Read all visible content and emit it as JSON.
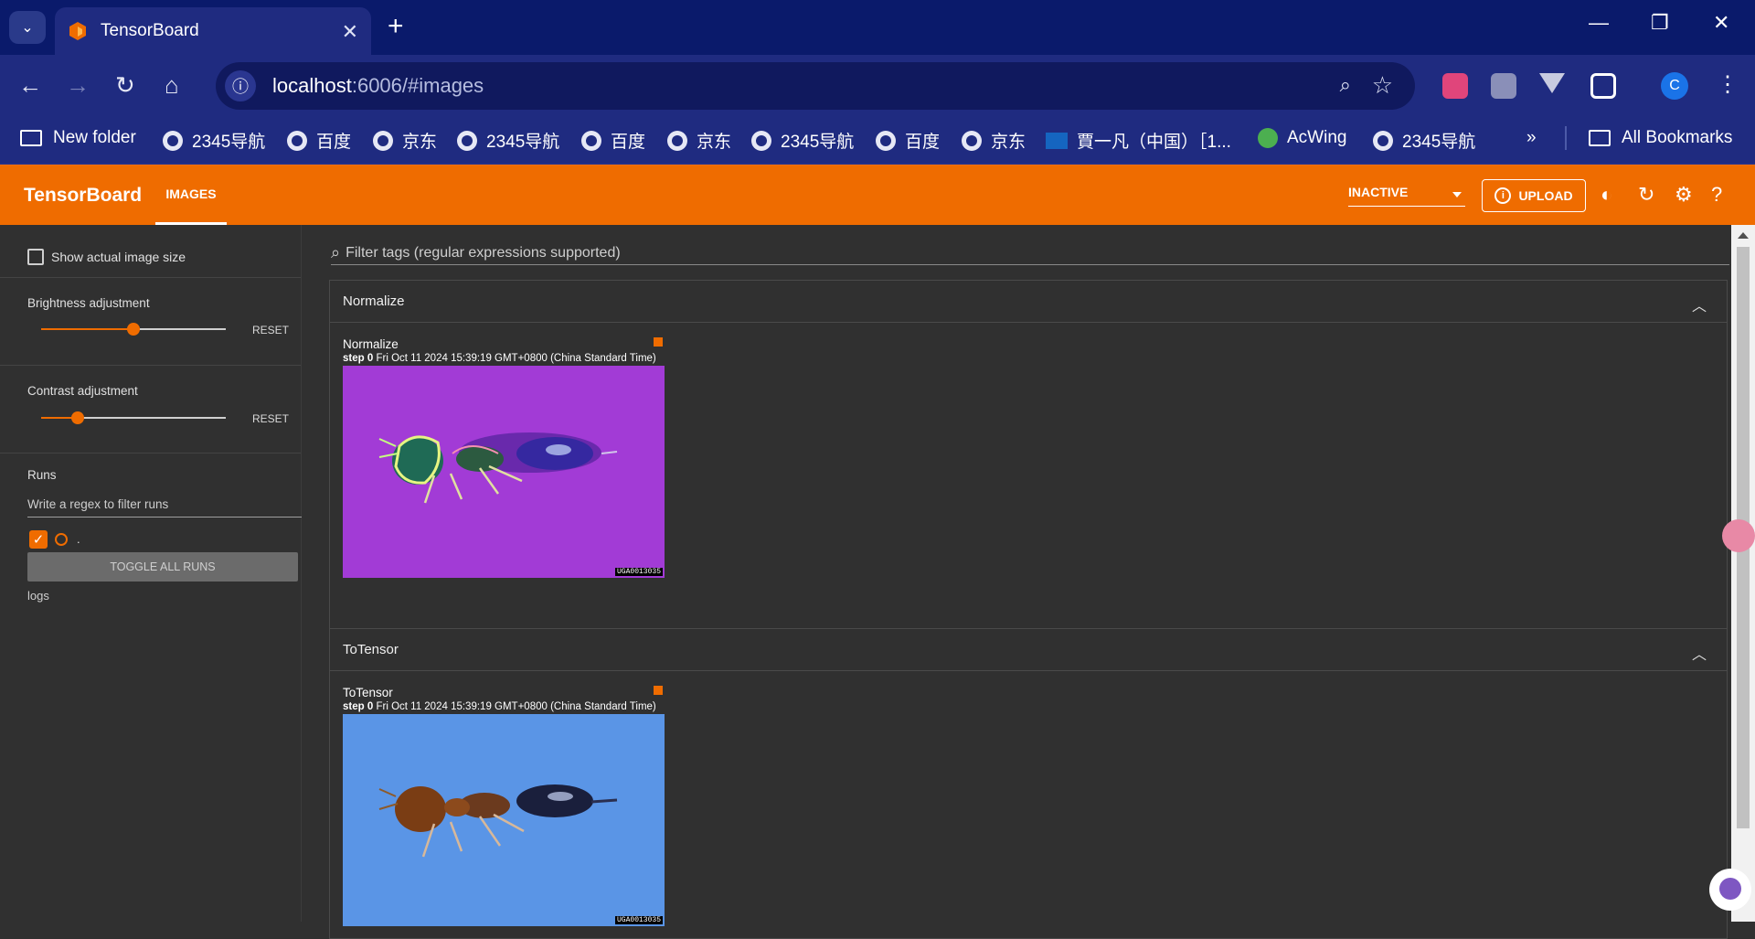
{
  "browser": {
    "tab_title": "TensorBoard",
    "url_host": "localhost",
    "url_rest": ":6006/#images",
    "profile_initial": "C",
    "bookmarks": [
      {
        "label": "New folder",
        "icon": "folder-icon"
      },
      {
        "label": "2345导航",
        "icon": "globe-icon"
      },
      {
        "label": "百度",
        "icon": "globe-icon"
      },
      {
        "label": "京东",
        "icon": "globe-icon"
      },
      {
        "label": "2345导航",
        "icon": "globe-icon"
      },
      {
        "label": "百度",
        "icon": "globe-icon"
      },
      {
        "label": "京东",
        "icon": "globe-icon"
      },
      {
        "label": "2345导航",
        "icon": "globe-icon"
      },
      {
        "label": "百度",
        "icon": "globe-icon"
      },
      {
        "label": "京东",
        "icon": "globe-icon"
      },
      {
        "label": "賈一凡（中国）［1...",
        "icon": "nhk-icon"
      },
      {
        "label": "AcWing",
        "icon": "acwing-icon"
      },
      {
        "label": "2345导航",
        "icon": "globe-icon"
      }
    ],
    "all_bookmarks": "All Bookmarks"
  },
  "tensorboard": {
    "title": "TensorBoard",
    "active_tab": "IMAGES",
    "run_state": "INACTIVE",
    "upload_label": "UPLOAD",
    "accent_color": "#ef6c00"
  },
  "sidebar": {
    "show_actual_size": "Show actual image size",
    "brightness_label": "Brightness adjustment",
    "brightness_value": 0.5,
    "contrast_label": "Contrast adjustment",
    "contrast_value": 0.2,
    "reset_label": "RESET",
    "runs_label": "Runs",
    "runs_filter_placeholder": "Write a regex to filter runs",
    "run_item": ".",
    "toggle_all": "TOGGLE ALL RUNS",
    "run_dir": "logs"
  },
  "main": {
    "filter_placeholder": "Filter tags (regular expressions supported)",
    "groups": [
      {
        "name": "Normalize",
        "card_title": "Normalize",
        "step_label": "step",
        "step_value": "0",
        "timestamp": "Fri Oct 11 2024 15:39:19 GMT+0800 (China Standard Time)",
        "image_caption": "UGA0013035"
      },
      {
        "name": "ToTensor",
        "card_title": "ToTensor",
        "step_label": "step",
        "step_value": "0",
        "timestamp": "Fri Oct 11 2024 15:39:19 GMT+0800 (China Standard Time)",
        "image_caption": "UGA0013035"
      }
    ]
  }
}
